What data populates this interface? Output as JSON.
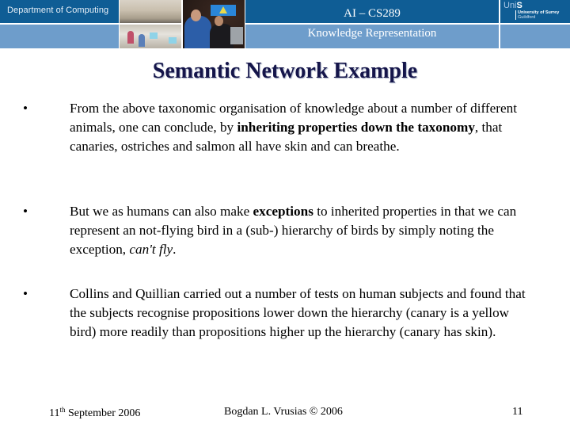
{
  "header": {
    "department": "Department of Computing",
    "course_code": "AI – CS289",
    "course_name": "Knowledge Representation",
    "logo": {
      "unis_light": "Uni",
      "unis_bold": "S",
      "university": "University of Surrey",
      "location": "Guildford"
    },
    "colors": {
      "dark_band": "#0f5d95",
      "light_band": "#6e9dcb"
    }
  },
  "slide": {
    "title": "Semantic Network Example",
    "title_color": "#15154a",
    "bullets": [
      {
        "parts": [
          {
            "text": "From the above taxonomic organisation of knowledge about a number of different animals, one can conclude, by ",
            "style": "normal"
          },
          {
            "text": "inheriting properties down the taxonomy",
            "style": "bold"
          },
          {
            "text": ", that canaries, ostriches and salmon all have skin and can breathe.",
            "style": "normal"
          }
        ]
      },
      {
        "parts": [
          {
            "text": "But we as humans can also make ",
            "style": "normal"
          },
          {
            "text": "exceptions",
            "style": "bold"
          },
          {
            "text": " to inherited properties in that we can represent an not-flying bird in a (sub-) hierarchy of birds by simply noting the exception, ",
            "style": "normal"
          },
          {
            "text": "can't fly",
            "style": "italic"
          },
          {
            "text": ".",
            "style": "normal"
          }
        ]
      },
      {
        "parts": [
          {
            "text": "Collins and Quillian carried out a number of tests on human subjects and found that the subjects recognise propositions lower down the hierarchy (canary is a yellow bird) more readily than propositions higher up the hierarchy (canary has skin).",
            "style": "normal"
          }
        ]
      }
    ],
    "bullet_glyph": "•"
  },
  "footer": {
    "date_day": "11",
    "date_suffix": "th",
    "date_rest": " September 2006",
    "author": "Bogdan L. Vrusias © 2006",
    "page_number": "11"
  }
}
